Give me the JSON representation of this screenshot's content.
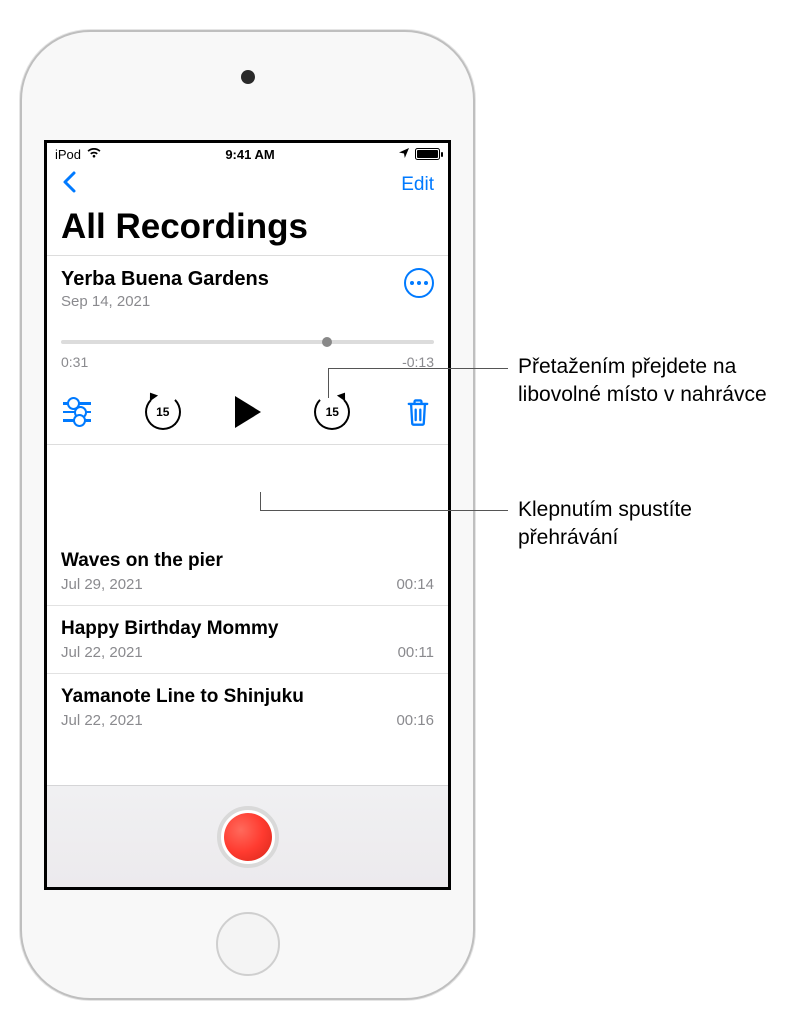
{
  "status": {
    "carrier": "iPod",
    "time": "9:41 AM"
  },
  "nav": {
    "edit_label": "Edit"
  },
  "page_title": "All Recordings",
  "selected": {
    "title": "Yerba Buena Gardens",
    "date": "Sep 14, 2021",
    "elapsed": "0:31",
    "remaining": "-0:13",
    "skip_seconds": "15"
  },
  "recordings": [
    {
      "title": "Waves on the pier",
      "date": "Jul 29, 2021",
      "duration": "00:14"
    },
    {
      "title": "Happy Birthday Mommy",
      "date": "Jul 22, 2021",
      "duration": "00:11"
    },
    {
      "title": "Yamanote Line to Shinjuku",
      "date": "Jul 22, 2021",
      "duration": "00:16"
    }
  ],
  "callouts": {
    "scrub": "Přetažením přejdete na libovolné místo v nahrávce",
    "play": "Klepnutím spustíte přehrávání"
  }
}
